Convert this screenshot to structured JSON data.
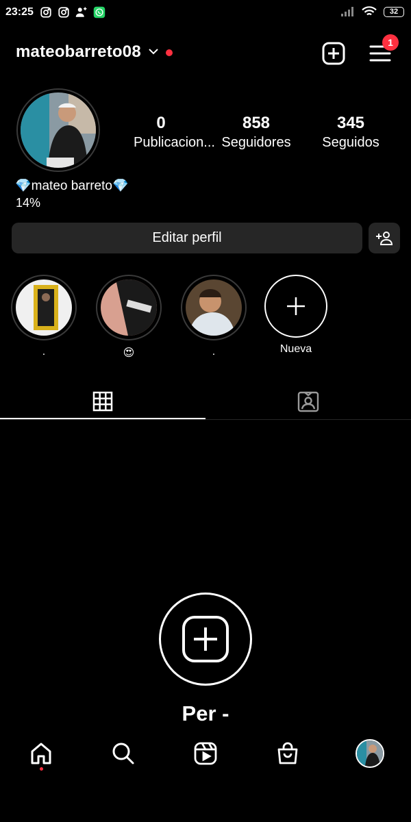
{
  "status_bar": {
    "time": "23:25",
    "battery": "32",
    "left_icons": [
      "instagram-icon",
      "instagram-icon",
      "add-user-icon",
      "whatsapp-icon"
    ],
    "right_icons": [
      "signal-icon",
      "wifi-icon",
      "battery-icon"
    ]
  },
  "header": {
    "username": "mateobarreto08",
    "menu_badge": "1",
    "accent_color": "#ff3040"
  },
  "profile": {
    "stats": [
      {
        "value": "0",
        "label": "Publicacion..."
      },
      {
        "value": "858",
        "label": "Seguidores"
      },
      {
        "value": "345",
        "label": "Seguidos"
      }
    ],
    "display_name": "💎mateo barreto💎",
    "bio": "14%",
    "edit_button": "Editar perfil"
  },
  "highlights": [
    {
      "label": "."
    },
    {
      "label": "😍"
    },
    {
      "label": "."
    },
    {
      "label": "Nueva"
    }
  ],
  "tabs": [
    "grid-icon",
    "tagged-icon"
  ],
  "empty_state": {
    "title": "Per -"
  },
  "bottom_nav": [
    "home-icon",
    "search-icon",
    "reels-icon",
    "shop-icon",
    "profile-avatar"
  ]
}
